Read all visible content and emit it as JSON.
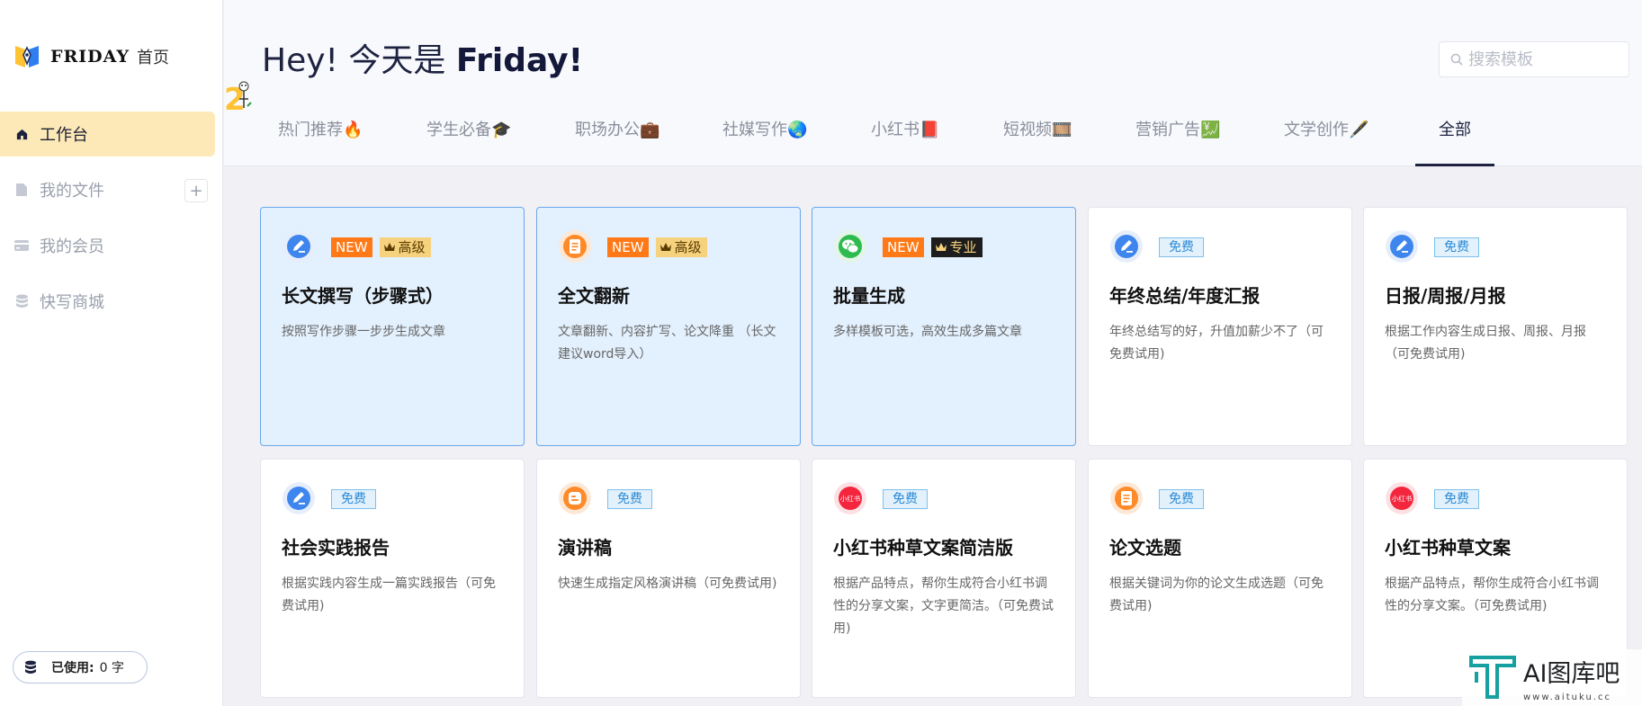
{
  "brand": {
    "name": "FRIDAY",
    "home": "首页"
  },
  "nav": [
    {
      "label": "工作台",
      "icon": "home-icon",
      "active": true
    },
    {
      "label": "我的文件",
      "icon": "file-icon",
      "active": false
    },
    {
      "label": "我的会员",
      "icon": "card-icon",
      "active": false
    },
    {
      "label": "快写商城",
      "icon": "coins-icon",
      "active": false
    }
  ],
  "usage": {
    "label": "已使用:",
    "value": "0 字"
  },
  "header": {
    "greeting": "Hey! 今天是 ",
    "day": "Friday!"
  },
  "search": {
    "placeholder": "搜索模板"
  },
  "tabs": [
    {
      "label": "热门推荐🔥"
    },
    {
      "label": "学生必备🎓"
    },
    {
      "label": "职场办公💼"
    },
    {
      "label": "社媒写作🌏"
    },
    {
      "label": "小红书📕"
    },
    {
      "label": "短视频🎞️"
    },
    {
      "label": "营销广告💹"
    },
    {
      "label": "文学创作🖋️"
    },
    {
      "label": "全部",
      "active": true
    }
  ],
  "badges": {
    "new": "NEW",
    "advanced": "高级",
    "pro": "专业",
    "free": "免费"
  },
  "cards": [
    {
      "title": "长文撰写（步骤式）",
      "desc": "按照写作步骤一步步生成文章",
      "icon": "pen-icon",
      "tier": "advanced",
      "isNew": true,
      "highlight": true
    },
    {
      "title": "全文翻新",
      "desc": "文章翻新、内容扩写、论文降重 （长文建议word导入）",
      "icon": "document-icon",
      "tier": "advanced",
      "isNew": true,
      "highlight": true
    },
    {
      "title": "批量生成",
      "desc": "多样模板可选，高效生成多篇文章",
      "icon": "wechat-icon",
      "tier": "pro",
      "isNew": true,
      "highlight": true
    },
    {
      "title": "年终总结/年度汇报",
      "desc": "年终总结写的好，升值加薪少不了（可免费试用)",
      "icon": "pen-icon",
      "tier": "free",
      "isNew": false,
      "highlight": false
    },
    {
      "title": "日报/周报/月报",
      "desc": "根据工作内容生成日报、周报、月报（可免费试用)",
      "icon": "pen-icon",
      "tier": "free",
      "isNew": false,
      "highlight": false
    },
    {
      "title": "社会实践报告",
      "desc": "根据实践内容生成一篇实践报告（可免费试用)",
      "icon": "pen-icon",
      "tier": "free",
      "isNew": false,
      "highlight": false
    },
    {
      "title": "演讲稿",
      "desc": "快速生成指定风格演讲稿（可免费试用)",
      "icon": "blogger-icon",
      "tier": "free",
      "isNew": false,
      "highlight": false
    },
    {
      "title": "小红书种草文案简洁版",
      "desc": "根据产品特点，帮你生成符合小红书调性的分享文案，文字更简洁。（可免费试用)",
      "icon": "xiaohongshu-icon",
      "tier": "free",
      "isNew": false,
      "highlight": false
    },
    {
      "title": "论文选题",
      "desc": "根据关键词为你的论文生成选题（可免费试用)",
      "icon": "document-icon",
      "tier": "free",
      "isNew": false,
      "highlight": false
    },
    {
      "title": "小红书种草文案",
      "desc": "根据产品特点，帮你生成符合小红书调性的分享文案。（可免费试用)",
      "icon": "xiaohongshu-icon",
      "tier": "free",
      "isNew": false,
      "highlight": false
    }
  ],
  "xhs_icon_text": "小红书",
  "watermark": {
    "title": "AI图库吧",
    "url": "www.aituku.cc"
  },
  "colors": {
    "accent": "#1d2240",
    "active_bg": "#fde9b8",
    "highlight_bg": "#e3f0fd",
    "new_badge": "#ff7a17",
    "free_badge": "#2b8ad6"
  }
}
